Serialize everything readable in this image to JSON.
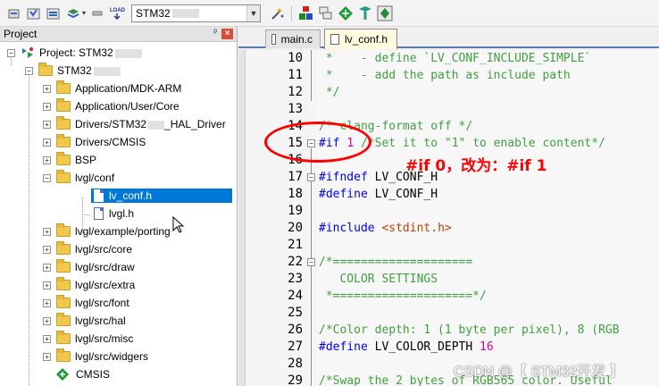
{
  "toolbar": {
    "target_name": "STM32",
    "dropdown_arrow": "▾",
    "icons": [
      "translate-icon",
      "build-icon",
      "rebuild-icon",
      "batch-build-icon",
      "load-icon",
      "target-options-icon",
      "manage-components-icon",
      "event-recorder-icon",
      "pack-installer-icon",
      "multi-project-icon"
    ]
  },
  "project_panel": {
    "title": "Project",
    "pin": "ᵖ",
    "close": "×",
    "root": "Project: STM32",
    "target": "STM32",
    "items": [
      {
        "label": "Application/MDK-ARM"
      },
      {
        "label": "Application/User/Core"
      },
      {
        "label": "Drivers/STM32",
        "label_suffix": "_HAL_Driver"
      },
      {
        "label": "Drivers/CMSIS"
      },
      {
        "label": "BSP"
      },
      {
        "label": "lvgl/conf"
      },
      {
        "label": "lv_conf.h"
      },
      {
        "label": "lvgl.h"
      },
      {
        "label": "lvgl/example/porting"
      },
      {
        "label": "lvgl/src/core"
      },
      {
        "label": "lvgl/src/draw"
      },
      {
        "label": "lvgl/src/extra"
      },
      {
        "label": "lvgl/src/font"
      },
      {
        "label": "lvgl/src/hal"
      },
      {
        "label": "lvgl/src/misc"
      },
      {
        "label": "lvgl/src/widgers"
      },
      {
        "label": "CMSIS"
      }
    ]
  },
  "editor": {
    "tabs": [
      {
        "label": "main.c",
        "active": false
      },
      {
        "label": "lv_conf.h",
        "active": true
      }
    ],
    "lines": [
      {
        "num": "10",
        "text": " *    - define `LV_CONF_INCLUDE_SIMPLE`",
        "kind": "comment"
      },
      {
        "num": "11",
        "text": " *    - add the path as include path",
        "kind": "comment"
      },
      {
        "num": "12",
        "text": " */",
        "kind": "comment"
      },
      {
        "num": "13",
        "text": "",
        "kind": "comment"
      },
      {
        "num": "14",
        "text": "/* clang-format off */",
        "kind": "comment"
      },
      {
        "num": "15",
        "text": "",
        "kind": "if"
      },
      {
        "num": "16",
        "text": "",
        "kind": "comment"
      },
      {
        "num": "17",
        "text": "",
        "kind": "ifndef"
      },
      {
        "num": "18",
        "text": "",
        "kind": "define"
      },
      {
        "num": "19",
        "text": "",
        "kind": "comment"
      },
      {
        "num": "20",
        "text": "",
        "kind": "include"
      },
      {
        "num": "21",
        "text": "",
        "kind": "comment"
      },
      {
        "num": "22",
        "text": "/*====================",
        "kind": "comment"
      },
      {
        "num": "23",
        "text": "   COLOR SETTINGS",
        "kind": "comment"
      },
      {
        "num": "24",
        "text": " *====================*/",
        "kind": "comment"
      },
      {
        "num": "25",
        "text": "",
        "kind": "comment"
      },
      {
        "num": "26",
        "text": "/*Color depth: 1 (1 byte per pixel), 8 (RGB",
        "kind": "comment"
      },
      {
        "num": "27",
        "text": "",
        "kind": "define2"
      },
      {
        "num": "28",
        "text": "",
        "kind": "comment"
      },
      {
        "num": "29",
        "text": "/*Swap the 2 bytes of RGB565 color. Useful",
        "kind": "comment"
      }
    ],
    "line15": {
      "kw": "#if",
      "val": "1",
      "cm": "/*Set it to \"1\" to enable content*/"
    },
    "line17": {
      "kw": "#ifndef",
      "rest": "LV_CONF_H"
    },
    "line18": {
      "kw": "#define",
      "rest": "LV_CONF_H"
    },
    "line20": {
      "kw": "#include",
      "rest": "<stdint.h>"
    },
    "line27": {
      "kw": "#define",
      "rest": "LV_COLOR_DEPTH",
      "val": "16"
    }
  },
  "annotation": {
    "text": "#if 0，改为：#if 1",
    "color": "#ff0000"
  },
  "watermark": "CSDN @【 STM32开发 】"
}
